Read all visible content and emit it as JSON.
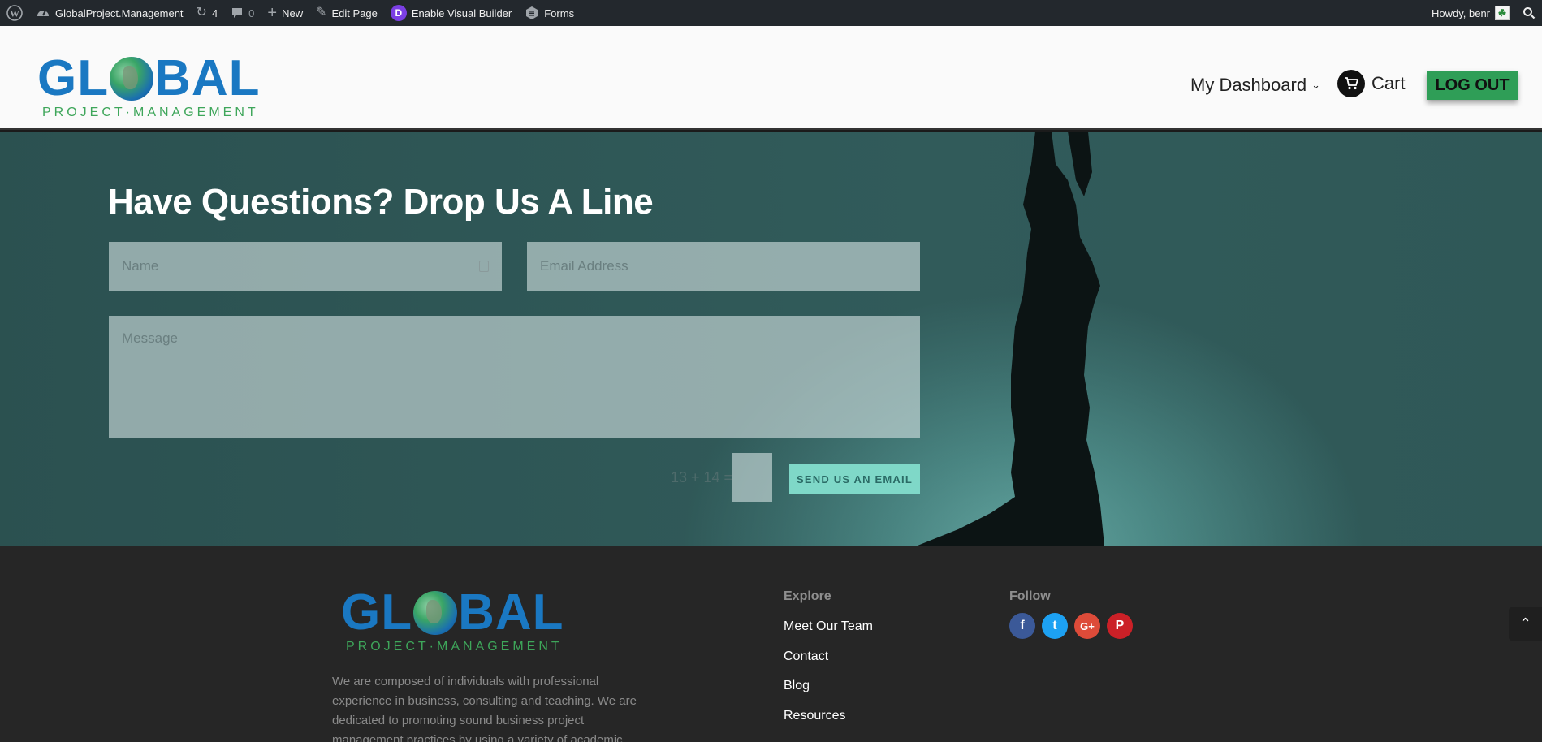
{
  "admin_bar": {
    "site_name": "GlobalProject.Management",
    "updates_count": "4",
    "comments_count": "0",
    "new_label": "New",
    "edit_page_label": "Edit Page",
    "visual_builder_label": "Enable Visual Builder",
    "forms_label": "Forms",
    "howdy_label": "Howdy, benr"
  },
  "header": {
    "logo_word_left": "GL",
    "logo_word_right": "BAL",
    "logo_sub": "PROJECT·MANAGEMENT",
    "nav_dashboard": "My Dashboard",
    "nav_cart": "Cart",
    "logout_label": "LOG OUT"
  },
  "contact": {
    "title": "Have Questions? Drop Us A Line",
    "name_placeholder": "Name",
    "email_placeholder": "Email Address",
    "message_placeholder": "Message",
    "captcha_question": "13 + 14 =",
    "captcha_value": "",
    "send_label": "SEND US AN EMAIL"
  },
  "footer": {
    "logo_word_left": "GL",
    "logo_word_right": "BAL",
    "logo_sub": "PROJECT·MANAGEMENT",
    "about_text": "We are composed of individuals with professional experience in business, consulting and teaching. We are dedicated to promoting sound business project management practices by using a variety of academic learning tools while also emphasizing ethical values and",
    "explore_heading": "Explore",
    "explore_links": [
      "Meet Our Team",
      "Contact",
      "Blog",
      "Resources"
    ],
    "follow_heading": "Follow",
    "social": [
      {
        "icon": "facebook-icon",
        "glyph": "f",
        "color": "#3b5998"
      },
      {
        "icon": "twitter-icon",
        "glyph": "t",
        "color": "#1da1f2"
      },
      {
        "icon": "google-plus-icon",
        "glyph": "G+",
        "color": "#dd4b39"
      },
      {
        "icon": "pinterest-icon",
        "glyph": "P",
        "color": "#cb2027"
      }
    ]
  },
  "colors": {
    "admin_bg": "#23282d",
    "brand_blue": "#1a78c2",
    "brand_green": "#3ea65a",
    "logout_bg": "#2f9e57",
    "send_bg": "#7fd8c8",
    "footer_bg": "#262626"
  }
}
